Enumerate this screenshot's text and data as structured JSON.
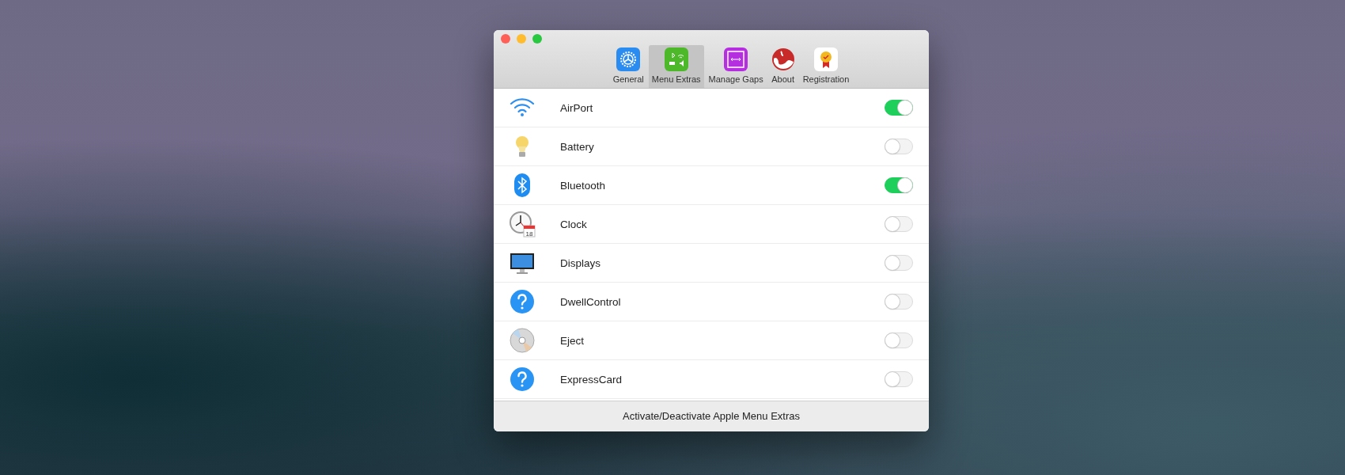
{
  "toolbar": {
    "tabs": [
      {
        "label": "General",
        "kind": "general",
        "selected": false
      },
      {
        "label": "Menu Extras",
        "kind": "extras",
        "selected": true
      },
      {
        "label": "Manage Gaps",
        "kind": "gaps",
        "selected": false
      },
      {
        "label": "About",
        "kind": "about",
        "selected": false
      },
      {
        "label": "Registration",
        "kind": "registration",
        "selected": false
      }
    ]
  },
  "items": [
    {
      "name": "AirPort",
      "kind": "wifi",
      "on": true
    },
    {
      "name": "Battery",
      "kind": "bulb",
      "on": false
    },
    {
      "name": "Bluetooth",
      "kind": "bluetooth",
      "on": true
    },
    {
      "name": "Clock",
      "kind": "clock",
      "icon_text": "18",
      "on": false
    },
    {
      "name": "Displays",
      "kind": "display",
      "on": false
    },
    {
      "name": "DwellControl",
      "kind": "question",
      "on": false
    },
    {
      "name": "Eject",
      "kind": "disc",
      "on": false
    },
    {
      "name": "ExpressCard",
      "kind": "question",
      "on": false
    }
  ],
  "footer": "Activate/Deactivate Apple Menu Extras"
}
